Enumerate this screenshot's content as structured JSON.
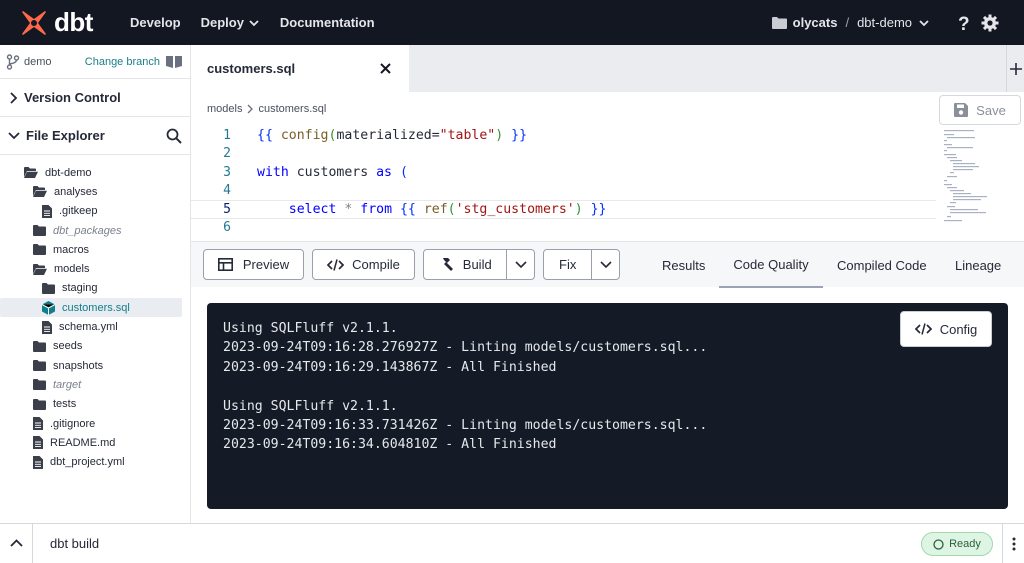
{
  "header": {
    "logo_text": "dbt",
    "brand_color": "#ff694a",
    "nav": [
      "Develop",
      "Deploy",
      "Documentation"
    ],
    "account": "olycats",
    "project": "dbt-demo"
  },
  "sidebar": {
    "branch": "demo",
    "change_branch": "Change branch",
    "version_control": "Version Control",
    "file_explorer": "File Explorer",
    "tree": [
      {
        "label": "dbt-demo",
        "icon": "folder-open-icon",
        "depth": 0,
        "dim": false
      },
      {
        "label": "analyses",
        "icon": "folder-open-icon",
        "depth": 1,
        "dim": false
      },
      {
        "label": ".gitkeep",
        "icon": "file-icon",
        "depth": 2,
        "dim": false
      },
      {
        "label": "dbt_packages",
        "icon": "folder-icon",
        "depth": 1,
        "dim": true
      },
      {
        "label": "macros",
        "icon": "folder-icon",
        "depth": 1,
        "dim": false
      },
      {
        "label": "models",
        "icon": "folder-open-icon",
        "depth": 1,
        "dim": false
      },
      {
        "label": "staging",
        "icon": "folder-icon",
        "depth": 2,
        "dim": false
      },
      {
        "label": "customers.sql",
        "icon": "model-cube-icon",
        "depth": 2,
        "dim": false,
        "selected": true
      },
      {
        "label": "schema.yml",
        "icon": "file-icon",
        "depth": 2,
        "dim": false
      },
      {
        "label": "seeds",
        "icon": "folder-icon",
        "depth": 1,
        "dim": false
      },
      {
        "label": "snapshots",
        "icon": "folder-icon",
        "depth": 1,
        "dim": false
      },
      {
        "label": "target",
        "icon": "folder-icon",
        "depth": 1,
        "dim": true
      },
      {
        "label": "tests",
        "icon": "folder-icon",
        "depth": 1,
        "dim": false
      },
      {
        "label": ".gitignore",
        "icon": "file-icon",
        "depth": 1,
        "dim": false
      },
      {
        "label": "README.md",
        "icon": "file-icon",
        "depth": 1,
        "dim": false
      },
      {
        "label": "dbt_project.yml",
        "icon": "file-icon",
        "depth": 1,
        "dim": false
      }
    ]
  },
  "editor": {
    "tab_title": "customers.sql",
    "path": [
      "models",
      "customers.sql"
    ],
    "save_label": "Save",
    "line_numbers": [
      "1",
      "2",
      "3",
      "4",
      "5",
      "6"
    ]
  },
  "toolbar": {
    "preview": "Preview",
    "compile": "Compile",
    "build": "Build",
    "fix": "Fix",
    "tabs": [
      "Results",
      "Code Quality",
      "Compiled Code",
      "Lineage"
    ],
    "active_tab": "Code Quality"
  },
  "console": {
    "config_label": "Config",
    "lines": [
      "Using SQLFluff v2.1.1.",
      "2023-09-24T09:16:28.276927Z - Linting models/customers.sql...",
      "2023-09-24T09:16:29.143867Z - All Finished",
      "",
      "Using SQLFluff v2.1.1.",
      "2023-09-24T09:16:33.731426Z - Linting models/customers.sql...",
      "2023-09-24T09:16:34.604810Z - All Finished"
    ]
  },
  "footer": {
    "command": "dbt build",
    "status": "Ready"
  }
}
